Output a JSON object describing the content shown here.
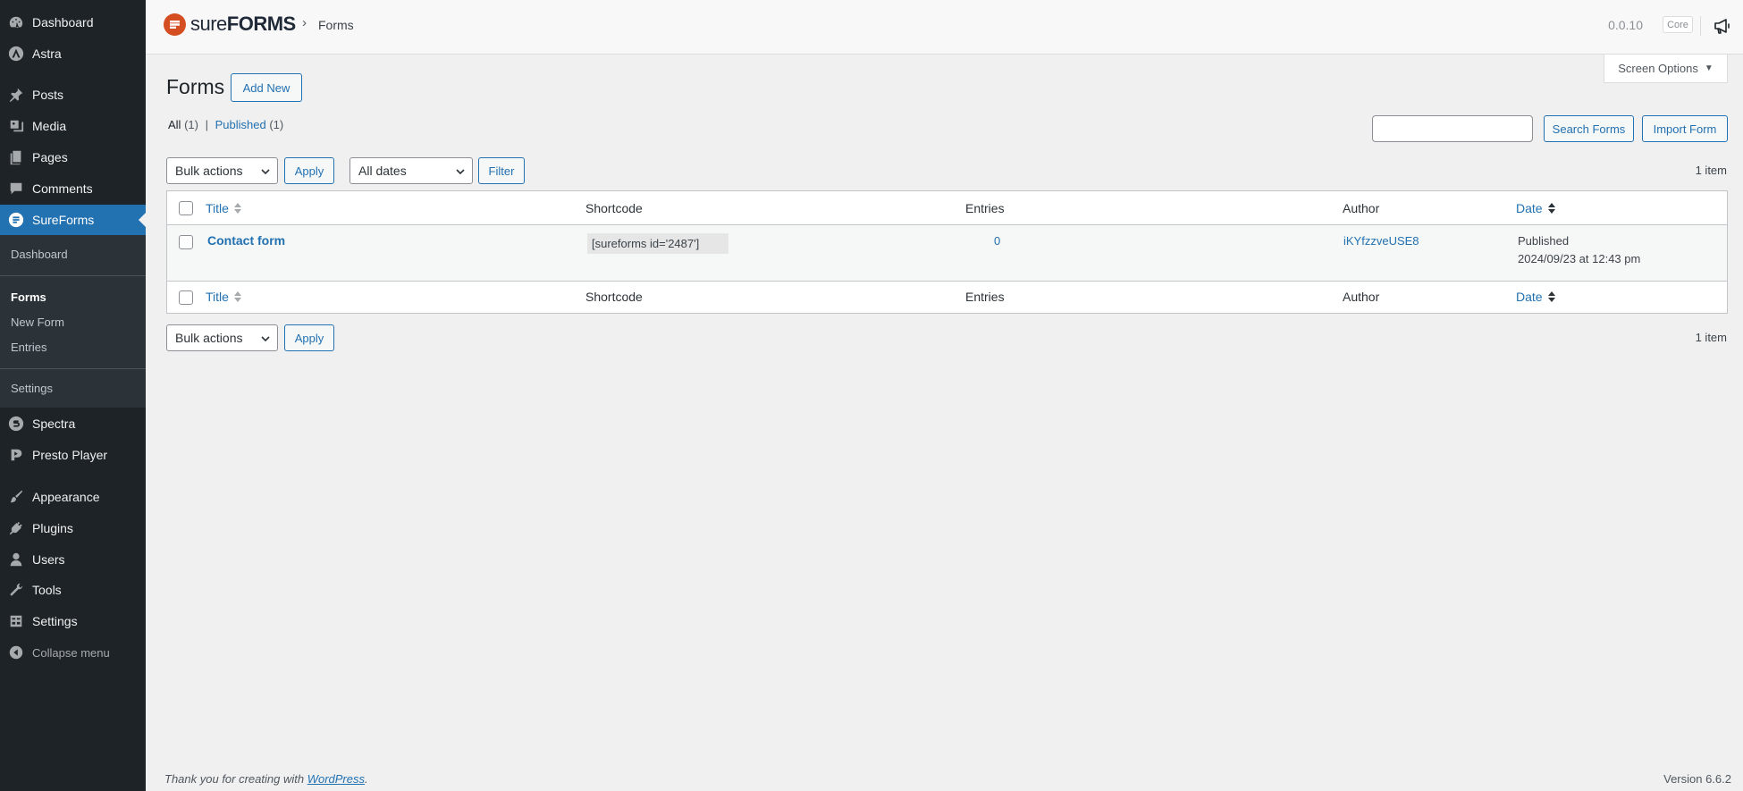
{
  "sidebar": {
    "items": [
      {
        "label": "Dashboard",
        "icon": "dashboard-icon"
      },
      {
        "label": "Astra",
        "icon": "astra-icon"
      },
      {
        "label": "Posts",
        "icon": "pushpin-icon"
      },
      {
        "label": "Media",
        "icon": "media-icon"
      },
      {
        "label": "Pages",
        "icon": "pages-icon"
      },
      {
        "label": "Comments",
        "icon": "comment-icon"
      },
      {
        "label": "SureForms",
        "icon": "sureforms-icon"
      },
      {
        "label": "Spectra",
        "icon": "spectra-icon"
      },
      {
        "label": "Presto Player",
        "icon": "presto-player-icon"
      },
      {
        "label": "Appearance",
        "icon": "paintbrush-icon"
      },
      {
        "label": "Plugins",
        "icon": "plugin-icon"
      },
      {
        "label": "Users",
        "icon": "user-icon"
      },
      {
        "label": "Tools",
        "icon": "wrench-icon"
      },
      {
        "label": "Settings",
        "icon": "settings-icon"
      }
    ],
    "submenu": {
      "dashboard": "Dashboard",
      "forms": "Forms",
      "new_form": "New Form",
      "entries": "Entries",
      "settings": "Settings"
    },
    "collapse_label": "Collapse menu",
    "accent_color": "#2271b1"
  },
  "header": {
    "logo_text_light": "sure",
    "logo_text_bold": "FORMS",
    "logo_color": "#d54e21",
    "breadcrumb_separator": "›",
    "breadcrumb": "Forms",
    "version": "0.0.10",
    "badge": "Core"
  },
  "screen_options_label": "Screen Options",
  "page": {
    "title": "Forms",
    "add_new_label": "Add New"
  },
  "views": {
    "all_label": "All",
    "all_count": "(1)",
    "separator": "|",
    "published_label": "Published",
    "published_count": "(1)"
  },
  "search": {
    "value": "",
    "search_button": "Search Forms",
    "import_button": "Import Form"
  },
  "tablenav_top": {
    "bulk_actions": "Bulk actions",
    "apply": "Apply",
    "dates": "All dates",
    "filter": "Filter",
    "items_count": "1 item"
  },
  "tablenav_bottom": {
    "bulk_actions": "Bulk actions",
    "apply": "Apply",
    "items_count": "1 item"
  },
  "table": {
    "columns": {
      "title": "Title",
      "shortcode": "Shortcode",
      "entries": "Entries",
      "author": "Author",
      "date": "Date"
    },
    "rows": [
      {
        "title": "Contact form",
        "shortcode": "[sureforms id='2487']",
        "entries": "0",
        "author": "iKYfzzveUSE8",
        "status": "Published",
        "date": "2024/09/23 at 12:43 pm"
      }
    ]
  },
  "footer": {
    "thanks_prefix": "Thank you for creating with",
    "wordpress_link": "WordPress",
    "thanks_suffix": ".",
    "version": "Version 6.6.2"
  }
}
